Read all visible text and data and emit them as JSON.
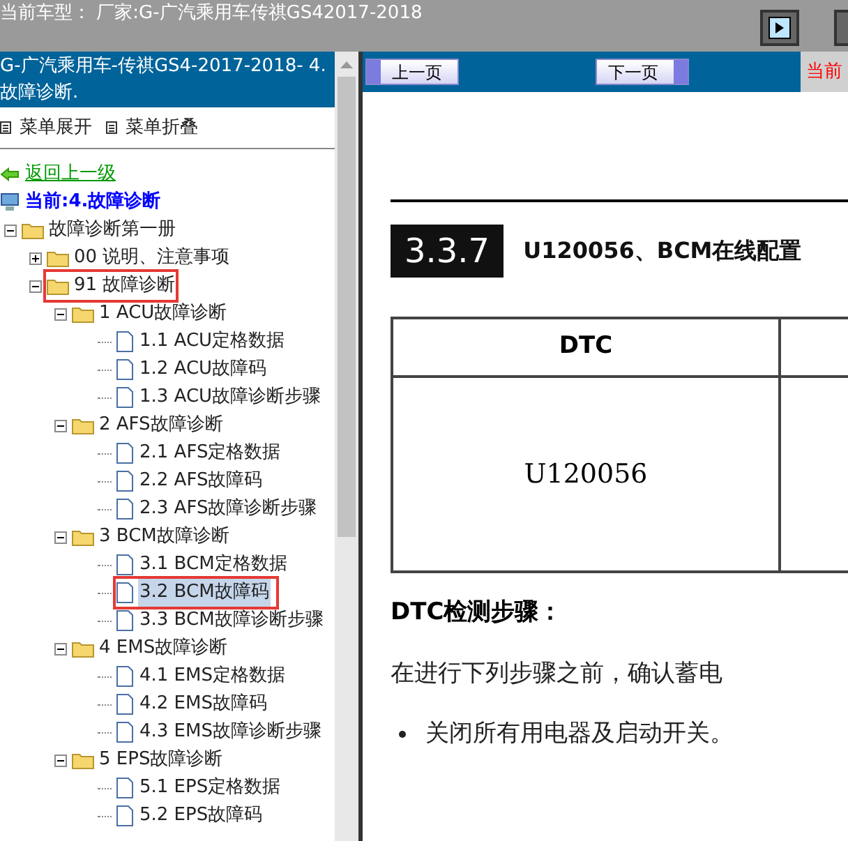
{
  "top_bar": {
    "title": "当前车型： 厂家:G-广汽乘用车传祺GS42017-2018"
  },
  "sidebar": {
    "header": "G-广汽乘用车-传祺GS4-2017-2018- 4.故障诊断.",
    "menu_actions": [
      "菜单展开",
      "菜单折叠"
    ],
    "back_link": "返回上一级",
    "tree": [
      {
        "kind": "computer",
        "label": "当前:4.故障诊断"
      },
      {
        "kind": "folder",
        "label": "故障诊断第一册",
        "expanded": true,
        "highlighted": false,
        "children": [
          {
            "kind": "folder",
            "label": "00 说明、注意事项",
            "expanded": false,
            "highlighted": false
          },
          {
            "kind": "folder",
            "label": "91 故障诊断",
            "expanded": true,
            "highlighted": true,
            "children": [
              {
                "kind": "folder",
                "label": "1 ACU故障诊断",
                "expanded": true,
                "highlighted": false,
                "children": [
                  {
                    "kind": "doc",
                    "label": "1.1 ACU定格数据",
                    "selected": false,
                    "highlighted": false
                  },
                  {
                    "kind": "doc",
                    "label": "1.2 ACU故障码",
                    "selected": false,
                    "highlighted": false
                  },
                  {
                    "kind": "doc",
                    "label": "1.3 ACU故障诊断步骤",
                    "selected": false,
                    "highlighted": false
                  }
                ]
              },
              {
                "kind": "folder",
                "label": "2 AFS故障诊断",
                "expanded": true,
                "highlighted": false,
                "children": [
                  {
                    "kind": "doc",
                    "label": "2.1 AFS定格数据",
                    "selected": false,
                    "highlighted": false
                  },
                  {
                    "kind": "doc",
                    "label": "2.2 AFS故障码",
                    "selected": false,
                    "highlighted": false
                  },
                  {
                    "kind": "doc",
                    "label": "2.3 AFS故障诊断步骤",
                    "selected": false,
                    "highlighted": false
                  }
                ]
              },
              {
                "kind": "folder",
                "label": "3 BCM故障诊断",
                "expanded": true,
                "highlighted": false,
                "children": [
                  {
                    "kind": "doc",
                    "label": "3.1 BCM定格数据",
                    "selected": false,
                    "highlighted": false
                  },
                  {
                    "kind": "doc",
                    "label": "3.2 BCM故障码",
                    "selected": true,
                    "highlighted": true
                  },
                  {
                    "kind": "doc",
                    "label": "3.3 BCM故障诊断步骤",
                    "selected": false,
                    "highlighted": false
                  }
                ]
              },
              {
                "kind": "folder",
                "label": "4 EMS故障诊断",
                "expanded": true,
                "highlighted": false,
                "children": [
                  {
                    "kind": "doc",
                    "label": "4.1 EMS定格数据",
                    "selected": false,
                    "highlighted": false
                  },
                  {
                    "kind": "doc",
                    "label": "4.2 EMS故障码",
                    "selected": false,
                    "highlighted": false
                  },
                  {
                    "kind": "doc",
                    "label": "4.3 EMS故障诊断步骤",
                    "selected": false,
                    "highlighted": false
                  }
                ]
              },
              {
                "kind": "folder",
                "label": "5 EPS故障诊断",
                "expanded": true,
                "highlighted": false,
                "children": [
                  {
                    "kind": "doc",
                    "label": "5.1 EPS定格数据",
                    "selected": false,
                    "highlighted": false
                  },
                  {
                    "kind": "doc",
                    "label": "5.2 EPS故障码",
                    "selected": false,
                    "highlighted": false
                  }
                ]
              }
            ]
          }
        ]
      }
    ]
  },
  "nav": {
    "prev": "上一页",
    "next": "下一页",
    "current": "当前"
  },
  "document": {
    "section_number": "3.3.7",
    "section_title": "U120056、BCM在线配置",
    "table": {
      "columns": [
        "DTC"
      ],
      "rows": [
        [
          "U120056"
        ]
      ]
    },
    "subheading": "DTC检测步骤：",
    "paragraph": "在进行下列步骤之前，确认蓄电",
    "bullets": [
      "关闭所有用电器及启动开关。"
    ]
  }
}
